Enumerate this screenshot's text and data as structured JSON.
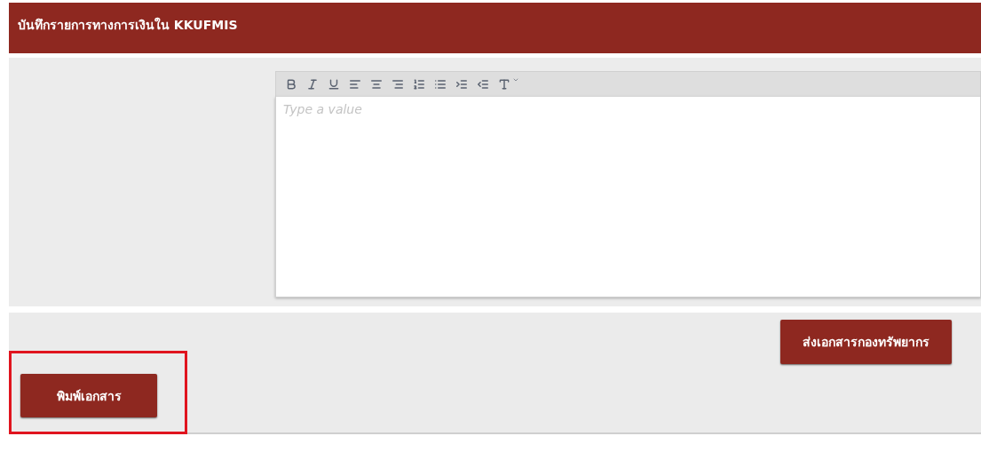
{
  "header": {
    "title": "บันทึกรายการทางการเงินใน KKUFMIS"
  },
  "editor": {
    "placeholder": "Type a value"
  },
  "actions": [
    {
      "label": "ส่งเอกสารกองทรัพยากร",
      "kind": "right",
      "highlighted": false
    },
    {
      "label": "พิมพ์เอกสาร",
      "kind": "left",
      "highlighted": true
    }
  ]
}
